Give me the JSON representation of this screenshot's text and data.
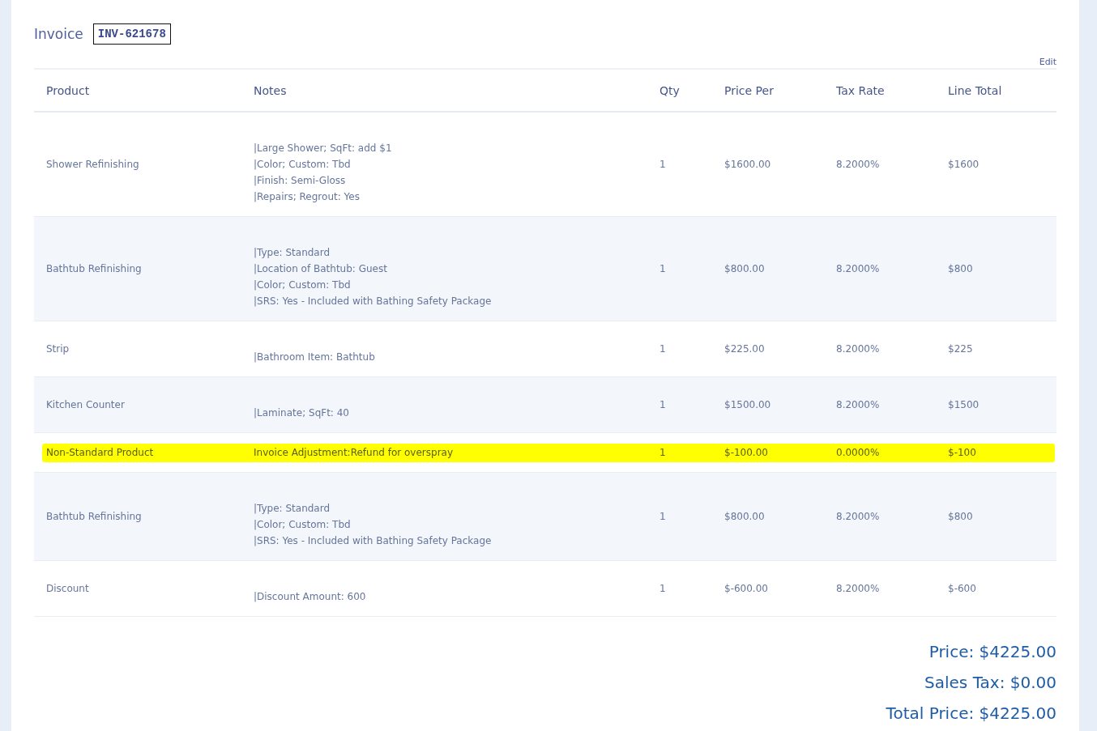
{
  "invoice": {
    "title": "Invoice",
    "number": "INV-621678",
    "edit_link": "Edit"
  },
  "table": {
    "columns": [
      "Product",
      "Notes",
      "Qty",
      "Price Per",
      "Tax Rate",
      "Line Total"
    ],
    "rows": [
      {
        "kind": "item",
        "highlighted": false,
        "product": "Shower Refinishing",
        "notes": [
          "|Large Shower; SqFt: add $1",
          "|Color; Custom: Tbd",
          "|Finish: Semi-Gloss",
          "|Repairs; Regrout: Yes"
        ],
        "qty": "1",
        "price_per": "$1600.00",
        "tax_rate": "8.2000%",
        "line_total": "$1600"
      },
      {
        "kind": "item",
        "highlighted": false,
        "product": "Bathtub Refinishing",
        "notes": [
          "|Type: Standard",
          "|Location of Bathtub: Guest",
          "|Color; Custom: Tbd",
          "|SRS: Yes - Included with Bathing Safety Package"
        ],
        "qty": "1",
        "price_per": "$800.00",
        "tax_rate": "8.2000%",
        "line_total": "$800"
      },
      {
        "kind": "item",
        "highlighted": false,
        "product": "Strip",
        "notes": [
          "|Bathroom Item: Bathtub"
        ],
        "qty": "1",
        "price_per": "$225.00",
        "tax_rate": "8.2000%",
        "line_total": "$225"
      },
      {
        "kind": "item",
        "highlighted": false,
        "product": "Kitchen Counter",
        "notes": [
          "|Laminate; SqFt: 40"
        ],
        "qty": "1",
        "price_per": "$1500.00",
        "tax_rate": "8.2000%",
        "line_total": "$1500"
      },
      {
        "kind": "adjustment",
        "highlighted": true,
        "product": "Non-Standard Product",
        "notes": [
          "Invoice Adjustment:Refund for overspray"
        ],
        "qty": "1",
        "price_per": "$-100.00",
        "tax_rate": "0.0000%",
        "line_total": "$-100"
      },
      {
        "kind": "item",
        "highlighted": false,
        "product": "Bathtub Refinishing",
        "notes": [
          "|Type: Standard",
          "|Color; Custom: Tbd",
          "|SRS: Yes - Included with Bathing Safety Package"
        ],
        "qty": "1",
        "price_per": "$800.00",
        "tax_rate": "8.2000%",
        "line_total": "$800"
      },
      {
        "kind": "item",
        "highlighted": false,
        "product": "Discount",
        "notes": [
          "|Discount Amount: 600"
        ],
        "qty": "1",
        "price_per": "$-600.00",
        "tax_rate": "8.2000%",
        "line_total": "$-600"
      }
    ]
  },
  "totals": [
    "Price: $4225.00",
    "Sales Tax: $0.00",
    "Total Price: $4225.00"
  ]
}
